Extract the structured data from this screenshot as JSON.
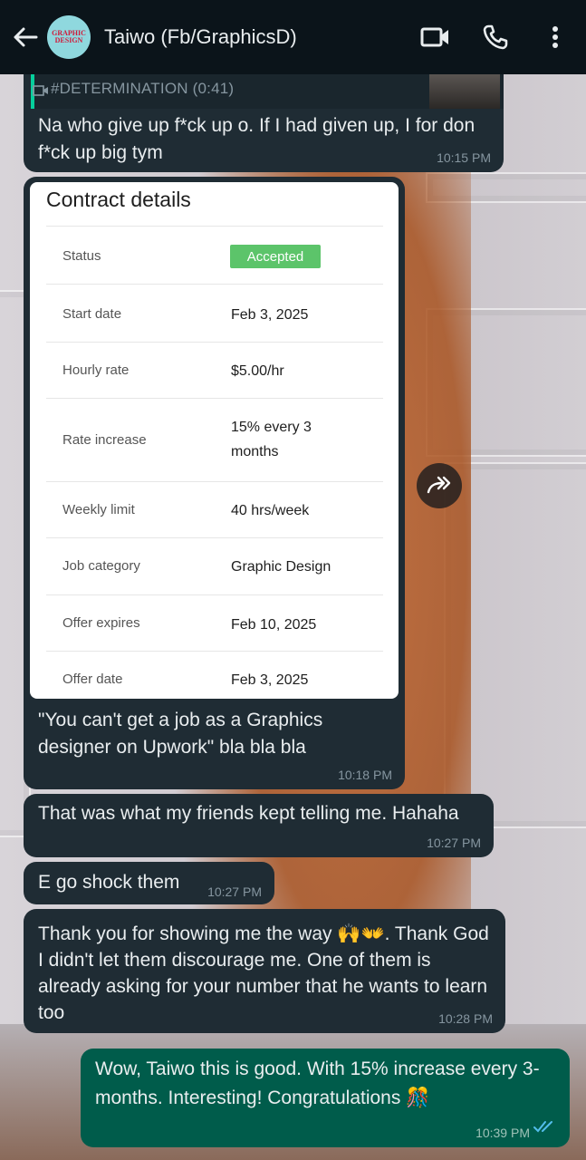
{
  "header": {
    "contact_name": "Taiwo (Fb/GraphicsD)",
    "avatar_text_line1": "GRAPHIC",
    "avatar_text_line2": "DESIGN"
  },
  "icons": [
    "back-arrow-icon",
    "video-call-icon",
    "voice-call-icon",
    "more-options-icon",
    "video-icon",
    "forward-icon",
    "double-check-icon"
  ],
  "quoted_message": {
    "title": "#DETERMINATION (0:41)"
  },
  "messages": [
    {
      "direction": "in",
      "text": "Na who give up f*ck up o. If I had given up, I for don f*ck up big tym",
      "time": "10:15 PM"
    },
    {
      "direction": "in",
      "caption": "\"You can't get a job as a Graphics designer on Upwork\" bla bla bla",
      "time": "10:18 PM"
    },
    {
      "direction": "in",
      "text": "That was what my friends kept telling me. Hahaha",
      "time": "10:27 PM"
    },
    {
      "direction": "in",
      "text": "E go shock them",
      "time": "10:27 PM"
    },
    {
      "direction": "in",
      "text": "Thank you for showing me the way 🙌👐. Thank God I didn't let them discourage me. One of them is already asking for your number that he wants to learn too",
      "time": "10:28 PM"
    },
    {
      "direction": "out",
      "text": "Wow, Taiwo this is good. With 15% increase every 3-months. Interesting! Congratulations 🎊",
      "time": "10:39 PM"
    }
  ],
  "contract": {
    "title": "Contract details",
    "rows": [
      {
        "label": "Status",
        "value": "Accepted"
      },
      {
        "label": "Start date",
        "value": "Feb 3, 2025"
      },
      {
        "label": "Hourly rate",
        "value": "$5.00/hr"
      },
      {
        "label": "Rate increase",
        "value_line1": "15% every 3",
        "value_line2": "months"
      },
      {
        "label": "Weekly limit",
        "value": "40 hrs/week"
      },
      {
        "label": "Job category",
        "value": "Graphic Design"
      },
      {
        "label": "Offer expires",
        "value": "Feb 10, 2025"
      },
      {
        "label": "Offer date",
        "value": "Feb 3, 2025"
      }
    ]
  },
  "colors": {
    "header_bg": "#0b141a",
    "incoming_bubble": "#1f2c34",
    "outgoing_bubble": "#005c4b",
    "status_badge": "#5cc46a",
    "read_tick": "#53bdeb"
  }
}
